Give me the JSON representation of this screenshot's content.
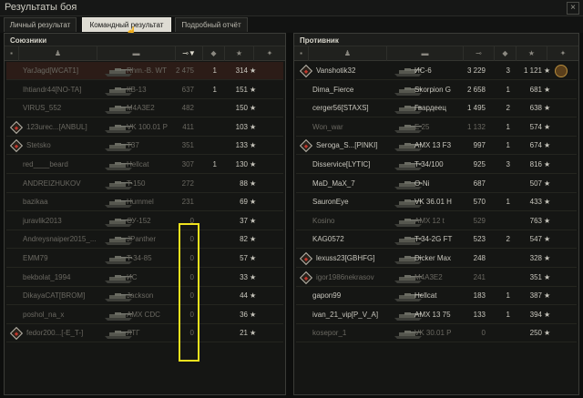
{
  "window": {
    "title": "Результаты боя",
    "close_label": "×"
  },
  "tabs": [
    {
      "label": "Личный результат",
      "active": false
    },
    {
      "label": "Командный результат",
      "active": true
    },
    {
      "label": "Подробный отчёт",
      "active": false
    }
  ],
  "allies": {
    "title": "Союзники",
    "rows": [
      {
        "player": "YarJagd[WCAT1]",
        "tank": "Rhm.-B. WT",
        "damage": "2 475",
        "kills": "1",
        "xp": "314",
        "dead": true,
        "clan_icon": false,
        "highlight": true
      },
      {
        "player": "Ihtiandr44[NO-TA]",
        "tank": "КВ-13",
        "damage": "637",
        "kills": "1",
        "xp": "151",
        "dead": true,
        "clan_icon": false,
        "highlight": false
      },
      {
        "player": "VIRUS_552",
        "tank": "M4A3E2",
        "damage": "482",
        "kills": "",
        "xp": "150",
        "dead": true,
        "clan_icon": false,
        "highlight": false
      },
      {
        "player": "123urec...[ANBUL]",
        "tank": "VK 100.01 P",
        "damage": "411",
        "kills": "",
        "xp": "103",
        "dead": true,
        "clan_icon": true,
        "highlight": false
      },
      {
        "player": "Stetsko",
        "tank": "T37",
        "damage": "351",
        "kills": "",
        "xp": "133",
        "dead": true,
        "clan_icon": true,
        "highlight": false
      },
      {
        "player": "red____beard",
        "tank": "Hellcat",
        "damage": "307",
        "kills": "1",
        "xp": "130",
        "dead": true,
        "clan_icon": false,
        "highlight": false
      },
      {
        "player": "ANDREIZHUKOV",
        "tank": "T-150",
        "damage": "272",
        "kills": "",
        "xp": "88",
        "dead": true,
        "clan_icon": false,
        "highlight": false
      },
      {
        "player": "bazikaa",
        "tank": "Hummel",
        "damage": "231",
        "kills": "",
        "xp": "69",
        "dead": true,
        "clan_icon": false,
        "highlight": false
      },
      {
        "player": "juravlik2013",
        "tank": "СУ-152",
        "damage": "0",
        "kills": "",
        "xp": "37",
        "dead": true,
        "clan_icon": false,
        "highlight": false
      },
      {
        "player": "Andreysnaiper2015_...",
        "tank": "JPanther",
        "damage": "0",
        "kills": "",
        "xp": "82",
        "dead": true,
        "clan_icon": false,
        "highlight": false
      },
      {
        "player": "EMM79",
        "tank": "T-34-85",
        "damage": "0",
        "kills": "",
        "xp": "57",
        "dead": true,
        "clan_icon": false,
        "highlight": false
      },
      {
        "player": "bekbolat_1994",
        "tank": "ИС",
        "damage": "0",
        "kills": "",
        "xp": "33",
        "dead": true,
        "clan_icon": false,
        "highlight": false
      },
      {
        "player": "DikayaCAT[BROM]",
        "tank": "Jackson",
        "damage": "0",
        "kills": "",
        "xp": "44",
        "dead": true,
        "clan_icon": false,
        "highlight": false
      },
      {
        "player": "poshol_na_x",
        "tank": "AMX CDC",
        "damage": "0",
        "kills": "",
        "xp": "36",
        "dead": true,
        "clan_icon": false,
        "highlight": false
      },
      {
        "player": "fedor200...[-E_T-]",
        "tank": "ЛТГ",
        "damage": "0",
        "kills": "",
        "xp": "21",
        "dead": true,
        "clan_icon": true,
        "highlight": false
      }
    ]
  },
  "enemies": {
    "title": "Противник",
    "rows": [
      {
        "player": "Vanshotik32",
        "tank": "ИС-6",
        "damage": "3 229",
        "kills": "3",
        "xp": "1 121",
        "dead": false,
        "clan_icon": true,
        "medal": true
      },
      {
        "player": "Dima_Fierce",
        "tank": "Skorpion G",
        "damage": "2 658",
        "kills": "1",
        "xp": "681",
        "dead": false,
        "clan_icon": false,
        "medal": false
      },
      {
        "player": "cerger56[STAXS]",
        "tank": "Гвардеец",
        "damage": "1 495",
        "kills": "2",
        "xp": "638",
        "dead": false,
        "clan_icon": false,
        "medal": false
      },
      {
        "player": "Won_war",
        "tank": "E 25",
        "damage": "1 132",
        "kills": "1",
        "xp": "574",
        "dead": true,
        "clan_icon": false,
        "medal": false
      },
      {
        "player": "Seroga_S...[PINKI]",
        "tank": "AMX 13 F3",
        "damage": "997",
        "kills": "1",
        "xp": "674",
        "dead": false,
        "clan_icon": true,
        "medal": false
      },
      {
        "player": "Disservice[LYTIC]",
        "tank": "T-34/100",
        "damage": "925",
        "kills": "3",
        "xp": "816",
        "dead": false,
        "clan_icon": false,
        "medal": false
      },
      {
        "player": "MaD_MaX_7",
        "tank": "O-Ni",
        "damage": "687",
        "kills": "",
        "xp": "507",
        "dead": false,
        "clan_icon": false,
        "medal": false
      },
      {
        "player": "SauronEye",
        "tank": "VK 36.01 H",
        "damage": "570",
        "kills": "1",
        "xp": "433",
        "dead": false,
        "clan_icon": false,
        "medal": false
      },
      {
        "player": "Kosino",
        "tank": "AMX 12 t",
        "damage": "529",
        "kills": "",
        "xp": "763",
        "dead": true,
        "clan_icon": false,
        "medal": false
      },
      {
        "player": "KAG0572",
        "tank": "T-34-2G FT",
        "damage": "523",
        "kills": "2",
        "xp": "547",
        "dead": false,
        "clan_icon": false,
        "medal": false
      },
      {
        "player": "lexuss23[GBHFG]",
        "tank": "Dicker Max",
        "damage": "248",
        "kills": "",
        "xp": "328",
        "dead": false,
        "clan_icon": true,
        "medal": false
      },
      {
        "player": "igor1986nekrasov",
        "tank": "M4A3E2",
        "damage": "241",
        "kills": "",
        "xp": "351",
        "dead": true,
        "clan_icon": true,
        "medal": false
      },
      {
        "player": "gapon99",
        "tank": "Hellcat",
        "damage": "183",
        "kills": "1",
        "xp": "387",
        "dead": false,
        "clan_icon": false,
        "medal": false
      },
      {
        "player": "ivan_21_vip[P_V_A]",
        "tank": "AMX 13 75",
        "damage": "133",
        "kills": "1",
        "xp": "394",
        "dead": false,
        "clan_icon": false,
        "medal": false
      },
      {
        "player": "kosepor_1",
        "tank": "VK 30.01 P",
        "damage": "0",
        "kills": "",
        "xp": "250",
        "dead": true,
        "clan_icon": false,
        "medal": false
      }
    ]
  },
  "icons": {
    "star": "★",
    "sort_arrow": "▼",
    "medal": "medal-icon",
    "diamond": "platoon-icon"
  },
  "colors": {
    "highlight_box": "#f0e21e",
    "dead_text": "#6a6861",
    "alive_text": "#c8c6bd",
    "platoon_red": "#c2372c"
  }
}
